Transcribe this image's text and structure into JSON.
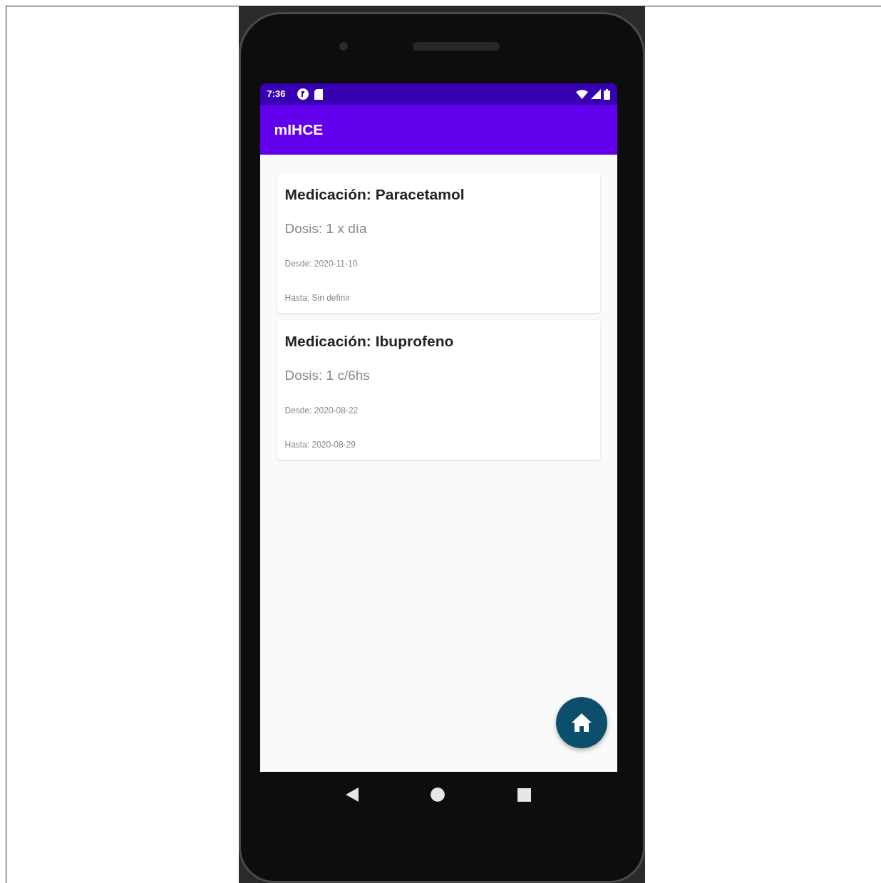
{
  "status_bar": {
    "time": "7:36"
  },
  "app_bar": {
    "title": "mIHCE"
  },
  "medications": [
    {
      "title": "Medicación: Paracetamol",
      "dose": "Dosis: 1 x día",
      "from": "Desde: 2020-11-10",
      "until": "Hasta: Sin definir"
    },
    {
      "title": "Medicación: Ibuprofeno",
      "dose": "Dosis: 1 c/6hs",
      "from": "Desde: 2020-08-22",
      "until": "Hasta: 2020-08-29"
    }
  ]
}
